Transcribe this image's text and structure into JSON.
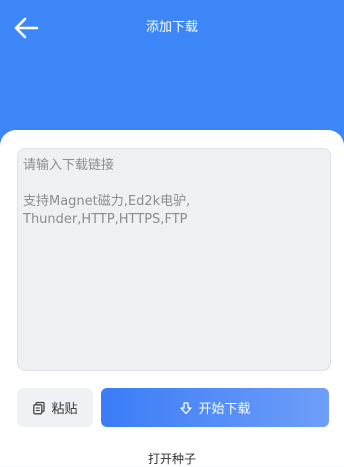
{
  "header": {
    "title": "添加下载",
    "back_icon": "arrow-left-icon",
    "background_color": "#3d86f8"
  },
  "input": {
    "placeholder": "请输入下载链接",
    "hint": "支持Magnet磁力,Ed2k电驴,Thunder,HTTP,HTTPS,FTP"
  },
  "actions": {
    "paste_label": "粘贴",
    "paste_icon": "paste-icon",
    "start_label": "开始下载",
    "start_icon": "download-icon",
    "open_seed_label": "打开种子"
  }
}
